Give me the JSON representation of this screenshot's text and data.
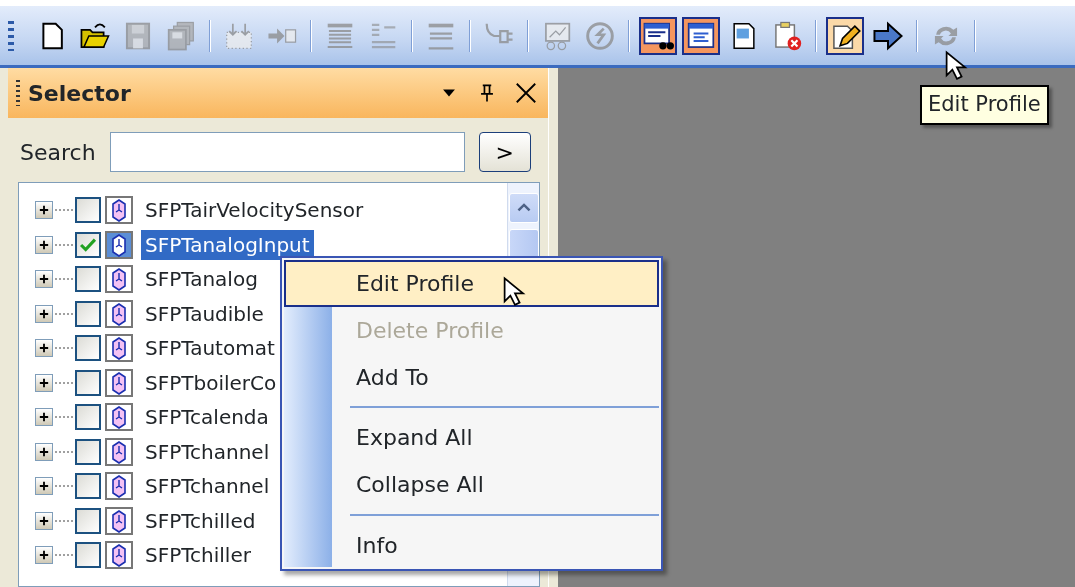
{
  "toolbar": [
    {
      "kind": "button",
      "disabled": false,
      "pressed": false,
      "hot": false
    },
    {
      "kind": "button",
      "disabled": false,
      "pressed": false,
      "hot": false
    },
    {
      "kind": "button",
      "disabled": true,
      "pressed": false,
      "hot": false
    },
    {
      "kind": "button",
      "disabled": true,
      "pressed": false,
      "hot": false
    },
    {
      "kind": "separator"
    },
    {
      "kind": "button",
      "disabled": true,
      "pressed": false,
      "hot": false
    },
    {
      "kind": "button",
      "disabled": true,
      "pressed": false,
      "hot": false
    },
    {
      "kind": "separator"
    },
    {
      "kind": "button",
      "disabled": true,
      "pressed": false,
      "hot": false
    },
    {
      "kind": "button",
      "disabled": true,
      "pressed": false,
      "hot": false
    },
    {
      "kind": "separator"
    },
    {
      "kind": "button",
      "disabled": true,
      "pressed": false,
      "hot": false
    },
    {
      "kind": "separator"
    },
    {
      "kind": "button",
      "disabled": true,
      "pressed": false,
      "hot": false
    },
    {
      "kind": "separator"
    },
    {
      "kind": "button",
      "disabled": true,
      "pressed": false,
      "hot": false
    },
    {
      "kind": "button",
      "disabled": true,
      "pressed": false,
      "hot": false
    },
    {
      "kind": "separator"
    },
    {
      "kind": "button",
      "disabled": false,
      "pressed": true,
      "hot": false
    },
    {
      "kind": "button",
      "disabled": false,
      "pressed": true,
      "hot": false
    },
    {
      "kind": "button",
      "disabled": false,
      "pressed": false,
      "hot": false
    },
    {
      "kind": "button",
      "disabled": false,
      "pressed": false,
      "hot": false
    },
    {
      "kind": "separator"
    },
    {
      "kind": "button",
      "disabled": false,
      "pressed": false,
      "hot": true
    },
    {
      "kind": "button",
      "disabled": false,
      "pressed": false,
      "hot": false
    },
    {
      "kind": "separator"
    },
    {
      "kind": "button",
      "disabled": true,
      "pressed": false,
      "hot": false
    },
    {
      "kind": "separator"
    }
  ],
  "tooltip": "Edit Profile",
  "panel": {
    "title": "Selector",
    "search_label": "Search",
    "go_button": ">"
  },
  "tree": {
    "rows": [
      {
        "label": "SFPTairVelocitySensor",
        "checked": false,
        "selected": false
      },
      {
        "label": "SFPTanalogInput",
        "checked": true,
        "selected": true
      },
      {
        "label": "SFPTanalog",
        "checked": false,
        "selected": false
      },
      {
        "label": "SFPTaudible",
        "checked": false,
        "selected": false
      },
      {
        "label": "SFPTautomat",
        "checked": false,
        "selected": false
      },
      {
        "label": "SFPTboilerCo",
        "checked": false,
        "selected": false
      },
      {
        "label": "SFPTcalenda",
        "checked": false,
        "selected": false
      },
      {
        "label": "SFPTchannel",
        "checked": false,
        "selected": false
      },
      {
        "label": "SFPTchannel",
        "checked": false,
        "selected": false
      },
      {
        "label": "SFPTchilled",
        "checked": false,
        "selected": false
      },
      {
        "label": "SFPTchiller",
        "checked": false,
        "selected": false
      }
    ]
  },
  "context_menu": {
    "items": [
      {
        "kind": "item",
        "label": "Edit Profile",
        "hot": true,
        "disabled": false
      },
      {
        "kind": "item",
        "label": "Delete Profile",
        "hot": false,
        "disabled": true
      },
      {
        "kind": "item",
        "label": "Add To",
        "hot": false,
        "disabled": false
      },
      {
        "kind": "separator"
      },
      {
        "kind": "item",
        "label": "Expand All",
        "hot": false,
        "disabled": false
      },
      {
        "kind": "item",
        "label": "Collapse All",
        "hot": false,
        "disabled": false
      },
      {
        "kind": "separator"
      },
      {
        "kind": "item",
        "label": "Info",
        "hot": false,
        "disabled": false
      }
    ]
  }
}
